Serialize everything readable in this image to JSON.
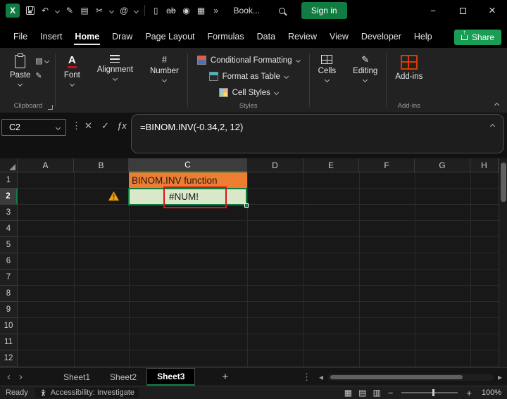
{
  "titlebar": {
    "workbook_name": "Book...",
    "sign_in": "Sign in"
  },
  "icons": {
    "logo": "X",
    "undo": "↶",
    "pen": "✎",
    "copy": "▤",
    "cut": "✂",
    "mention": "@",
    "new_doc": "▯",
    "strikethrough": "ab",
    "camera": "◉",
    "table": "▦",
    "more": "»",
    "minimize": "−",
    "close": "×",
    "dots": "⋮",
    "cancel": "✕",
    "enter": "✓",
    "insert_function": "ƒx",
    "font_letter": "A",
    "number_sign": "#",
    "editing_pencil": "✎",
    "scroll_up": "▲",
    "tab_prev": "‹",
    "tab_next": "›",
    "hscroll_left": "◂",
    "hscroll_right": "▸",
    "view_normal": "▦",
    "view_layout": "▤",
    "view_break": "▥",
    "zoom_out": "−",
    "zoom_in": "+"
  },
  "menubar": {
    "items": [
      "File",
      "Insert",
      "Home",
      "Draw",
      "Page Layout",
      "Formulas",
      "Data",
      "Review",
      "View",
      "Developer",
      "Help"
    ],
    "active_item": "Home",
    "share": "Share"
  },
  "ribbon": {
    "paste": "Paste",
    "clipboard_group": "Clipboard",
    "font": "Font",
    "alignment": "Alignment",
    "number": "Number",
    "conditional_formatting": "Conditional Formatting",
    "format_as_table": "Format as Table",
    "cell_styles": "Cell Styles",
    "styles_group": "Styles",
    "cells": "Cells",
    "editing": "Editing",
    "addins": "Add-ins",
    "addins_group": "Add-ins"
  },
  "formula_bar": {
    "cell_reference": "C2",
    "formula": "=BINOM.INV(-0.34,2, 12)"
  },
  "grid": {
    "columns": [
      "A",
      "B",
      "C",
      "D",
      "E",
      "F",
      "G",
      "H"
    ],
    "rows": [
      "1",
      "2",
      "3",
      "4",
      "5",
      "6",
      "7",
      "8",
      "9",
      "10",
      "11",
      "12"
    ],
    "c1_text": "BINOM.INV function",
    "c2_text": "#NUM!",
    "active_cell": "C2"
  },
  "sheetbar": {
    "tabs": [
      "Sheet1",
      "Sheet2",
      "Sheet3"
    ],
    "active_tab": "Sheet3",
    "add_sheet": "+"
  },
  "statusbar": {
    "ready": "Ready",
    "accessibility": "Accessibility: Investigate",
    "zoom": "100%"
  },
  "colors": {
    "accent_green": "#107C41",
    "share_green": "#1A9E55",
    "c1_fill_orange": "#ED7D31",
    "c2_fill_green": "#D9E8C9",
    "error_box_red": "#E01212",
    "warning_orange": "#F0A30A",
    "addins_orange": "#D83B01"
  }
}
